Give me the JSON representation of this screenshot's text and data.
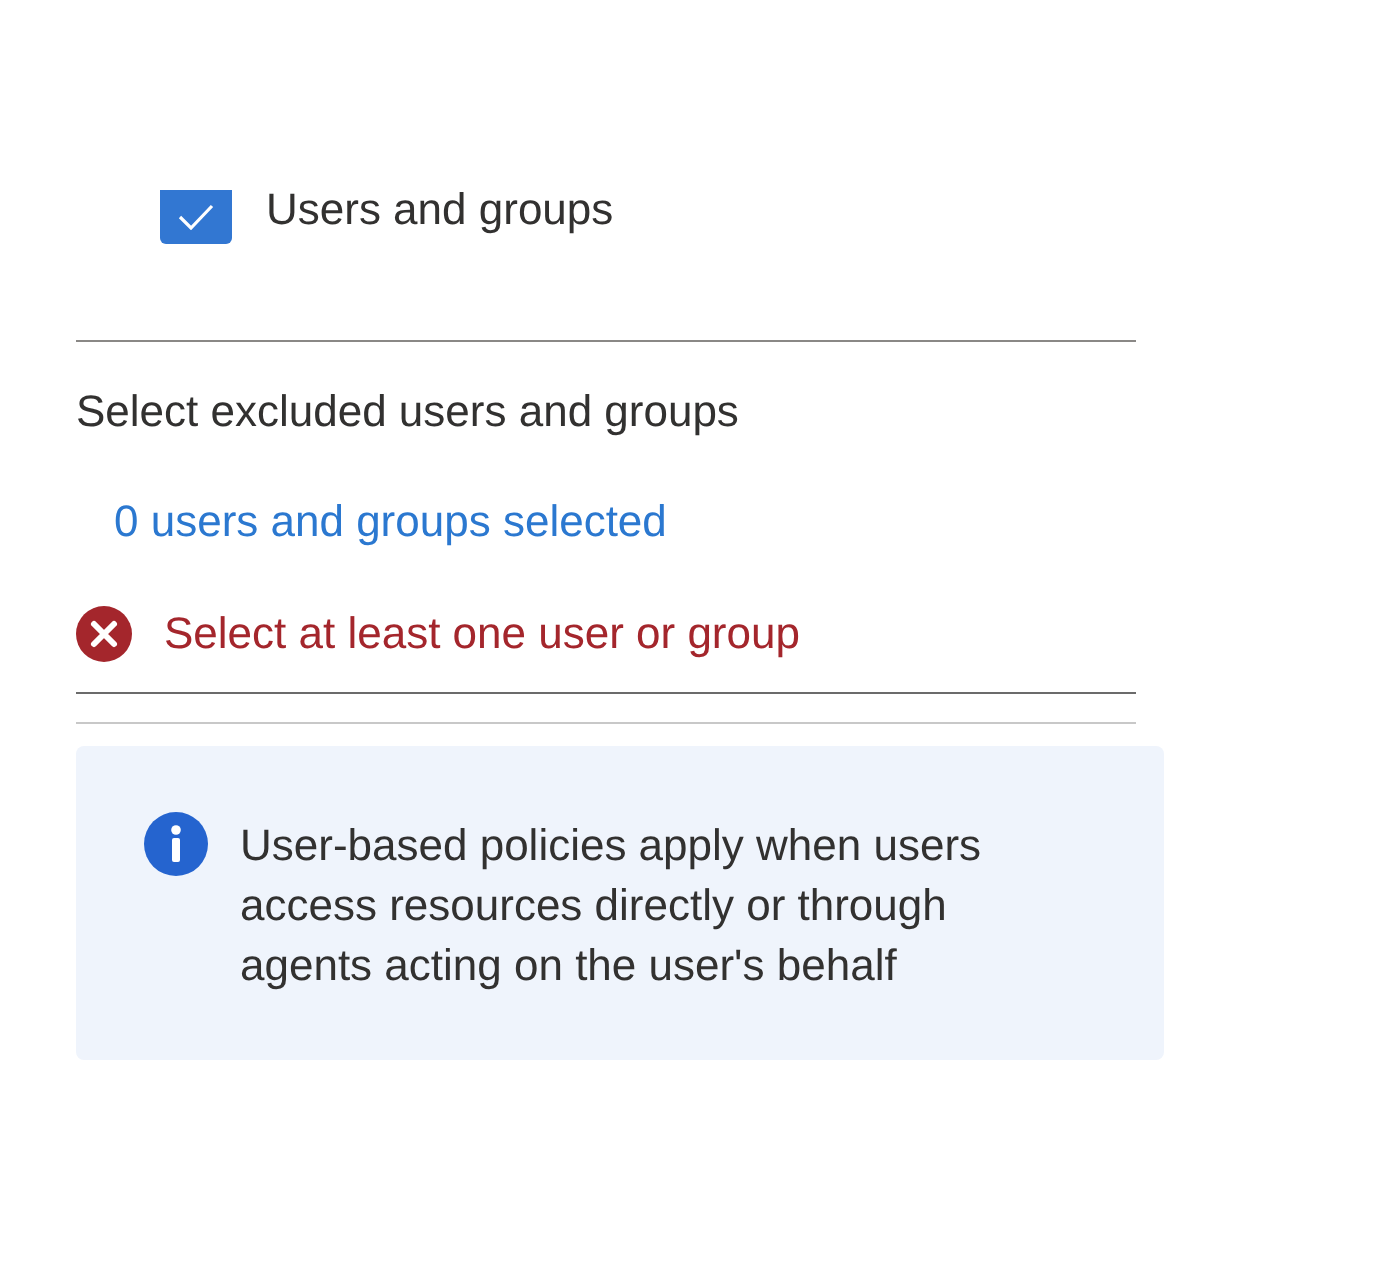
{
  "include_option": {
    "label": "Users and groups",
    "checked": true
  },
  "exclude_section": {
    "heading": "Select excluded users and groups",
    "selection_link": "0 users and groups selected",
    "error": "Select at least one user or group"
  },
  "info_message": {
    "text": "User-based policies apply when users access resources directly or through agents acting on the user's behalf"
  }
}
